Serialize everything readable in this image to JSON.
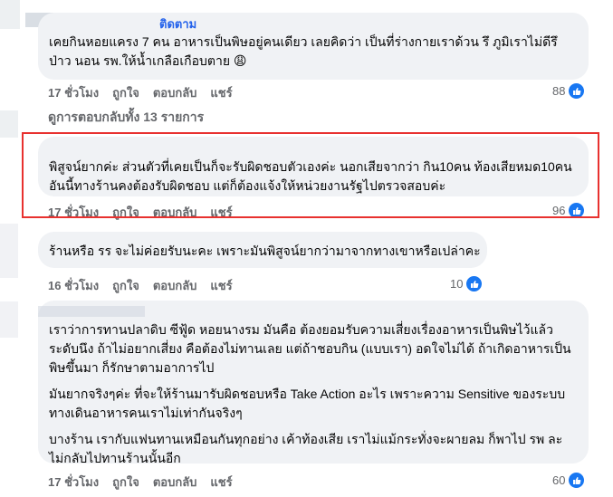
{
  "comments": [
    {
      "name_visible": "ติดตาม",
      "text": "เคยกินหอยแครง 7 คน อาหารเป็นพิษอยู่คนเดียว เลยคิดว่า เป็นที่ร่างกายเราด้วน รึ ภูมิเราไม่ดีรึป่าว นอน รพ.ให้น้ำเกลือเกือบตาย 😩",
      "time": "17 ชั่วโมง",
      "like": "ถูกใจ",
      "reply": "ตอบกลับ",
      "share": "แชร์",
      "reactions": "88"
    },
    {
      "text": "พิสูจน์ยากค่ะ ส่วนตัวที่เคยเป็นก็จะรับผิดชอบตัวเองค่ะ นอกเสียจากว่า กิน10คน ท้องเสียหมด10คน อันนี้ทางร้านคงต้องรับผิดชอบ แต่ก็ต้องแจ้งให้หน่วยงานรัฐไปตรวจสอบค่ะ",
      "time": "17 ชั่วโมง",
      "like": "ถูกใจ",
      "reply": "ตอบกลับ",
      "share": "แชร์",
      "reactions": "96"
    },
    {
      "text": "ร้านหรือ รร จะไม่ค่อยรับนะคะ เพราะมันพิสูจน์ยากว่ามาจากทางเขาหรือเปล่าคะ",
      "time": "16 ชั่วโมง",
      "like": "ถูกใจ",
      "reply": "ตอบกลับ",
      "share": "แชร์",
      "reactions": "10"
    },
    {
      "paragraphs": [
        "เราว่าการทานปลาดิบ ซีฟู้ด หอยนางรม มันคือ ต้องยอมรับความเสี่ยงเรื่องอาหารเป็นพิษไว้แล้ว ระดับนึง ถ้าไม่อยากเสี่ยง คือต้องไม่ทานเลย แต่ถ้าชอบกิน (แบบเรา) อดใจไม่ได้ ถ้าเกิดอาหารเป็นพิษขึ้นมา ก็รักษาตามอาการไป",
        "มันยากจริงๆค่ะ ที่จะให้ร้านมารับผิดชอบหรือ Take Action อะไร เพราะความ Sensitive ของระบบทางเดินอาหารคนเราไม่เท่ากันจริงๆ",
        "บางร้าน เรากับแฟนทานเหมือนกันทุกอย่าง เค้าท้องเสีย เราไม่แม้กระทั่งจะผายลม ก็พาไป รพ ละ ไม่กลับไปทานร้านนั้นอีก"
      ],
      "time": "17 ชั่วโมง",
      "like": "ถูกใจ",
      "reply": "ตอบกลับ",
      "share": "แชร์",
      "reactions": "60"
    }
  ],
  "view_replies": "ดูการตอบกลับทั้ง 13 รายการ",
  "colors": {
    "like_blue": "#1877f2",
    "highlight_red": "#e8312f",
    "bubble_bg": "#f0f2f5"
  }
}
